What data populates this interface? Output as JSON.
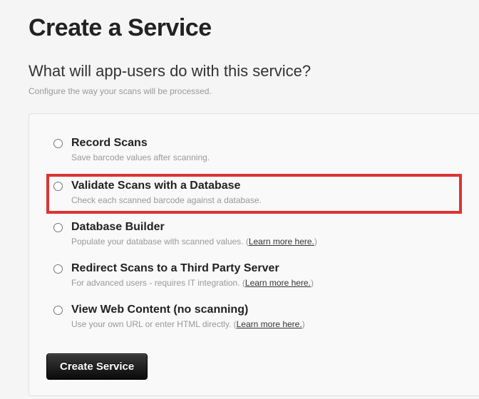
{
  "page_title": "Create a Service",
  "subtitle": "What will app-users do with this service?",
  "subdesc": "Configure the way your scans will be processed.",
  "options": [
    {
      "title": "Record Scans",
      "desc": "Save barcode values after scanning.",
      "highlighted": false,
      "learn_more": null
    },
    {
      "title": "Validate Scans with a Database",
      "desc": "Check each scanned barcode against a database.",
      "highlighted": true,
      "learn_more": null
    },
    {
      "title": "Database Builder",
      "desc": "Populate your database with scanned values. (",
      "highlighted": false,
      "learn_more": "Learn more here."
    },
    {
      "title": "Redirect Scans to a Third Party Server",
      "desc": "For advanced users - requires IT integration. (",
      "highlighted": false,
      "learn_more": "Learn more here."
    },
    {
      "title": "View Web Content (no scanning)",
      "desc": "Use your own URL or enter HTML directly. (",
      "highlighted": false,
      "learn_more": "Learn more here."
    }
  ],
  "create_button": "Create Service",
  "highlight_color": "#d33"
}
